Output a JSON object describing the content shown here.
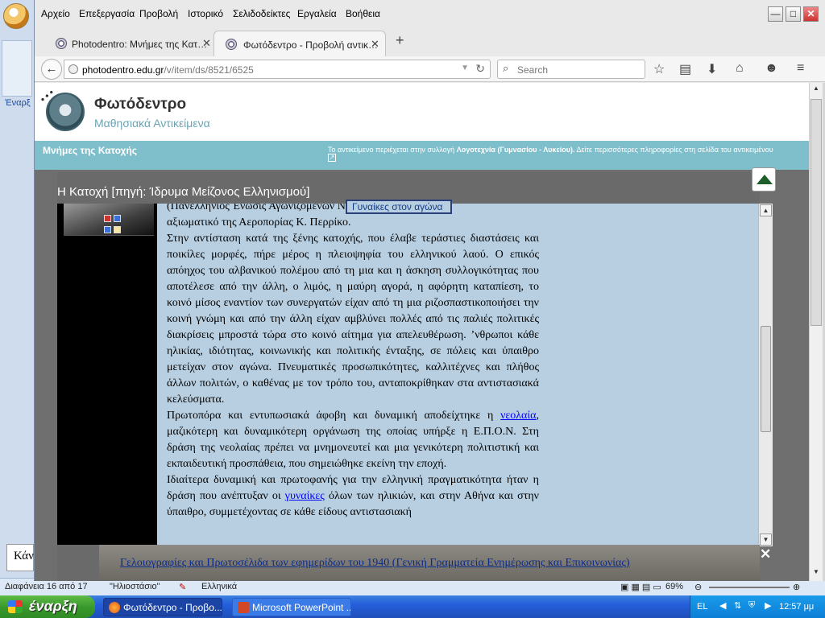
{
  "background_app": {
    "link_text": "Έναρξ",
    "thumb_text": "Κάν",
    "status_slide": "Διαφάνεια 16 από 17",
    "status_theme": "\"Ηλιοστάσιο\"",
    "status_lang": "Ελληνικά",
    "zoom": "69%"
  },
  "menu": [
    "Αρχείο",
    "Επεξεργασία",
    "Προβολή",
    "Ιστορικό",
    "Σελιδοδείκτες",
    "Εργαλεία",
    "Βοήθεια"
  ],
  "tabs": [
    {
      "title": "Photodentro: Μνήμες της Κατ…"
    },
    {
      "title": "Φωτόδεντρο - Προβολή αντικ…"
    }
  ],
  "navbar": {
    "url_host": "photodentro.edu.gr",
    "url_path": "/v/item/ds/8521/6525",
    "search_placeholder": "Search"
  },
  "site": {
    "title": "Φωτόδεντρο",
    "subtitle": "Μαθησιακά Αντικείμενα",
    "collection_title": "Μνήμες της Κατοχής",
    "info_prefix": "Το αντικείμενο περιέχεται στην συλλογή ",
    "info_collection": "Λογοτεχνία (Γυμνασίου - Λυκείου).",
    "info_suffix": " Δείτε περισσότερες πληροφορίες στη σελίδα του αντικειμένου"
  },
  "viewer": {
    "title": "Η Κατοχή [πηγή: Ίδρυμα Μείζονος Ελληνισμού]",
    "tag_box": "Γυναίκες στον αγώνα",
    "line_partial_1": "(Πανελλήνιος Ένωσις Αγωνιζομένων Νέων) που είχε ω",
    "line_partial_2": "αξιωματικό της Αεροπορίας Κ. Περρίκο.",
    "para1": "Στην αντίσταση κατά της ξένης κατοχής, που έλαβε τεράστιες διαστάσεις και ποικίλες μορφές, πήρε μέρος η πλειοψηφία του ελληνικού λαού. Ο επικός απόηχος του αλβανικού πολέμου από τη μια και η άσκηση συλλογικότητας που αποτέλεσε από την άλλη, ο λιμός, η μαύρη αγορά, η αφόρητη καταπίεση, το κοινό μίσος εναντίον των συνεργατών είχαν από τη μια ριζοσπαστικοποιήσει την κοινή γνώμη και από την άλλη είχαν αμβλύνει πολλές από τις παλιές πολιτικές διακρίσεις μπροστά τώρα στο κοινό αίτημα για απελευθέρωση. ʼνθρωποι κάθε ηλικίας, ιδιότητας, κοινωνικής και πολιτικής ένταξης, σε πόλεις και ύπαιθρο μετείχαν στον αγώνα. Πνευματικές προσωπικότητες, καλλιτέχνες και πλήθος άλλων πολιτών, ο καθένας με τον τρόπο του, ανταποκρίθηκαν στα αντιστασιακά κελεύσματα.",
    "para2_before": "Πρωτοπόρα και εντυπωσιακά άφοβη και δυναμική αποδείχτηκε η ",
    "para2_link": "νεολαία",
    "para2_after": ", μαζικότερη και δυναμικότερη οργάνωση της οποίας υπήρξε η Ε.Π.Ο.Ν. Στη δράση της νεολαίας πρέπει να μνημονευτεί και μια γενικότερη πολιτιστική και εκπαιδευτική προσπάθεια, που σημειώθηκε εκείνη την εποχή.",
    "para3_before": "Ιδιαίτερα δυναμική και πρωτοφανής για την ελληνική πραγματικότητα ήταν η δράση που ανέπτυξαν οι ",
    "para3_link": "γυναίκες",
    "para3_after": " όλων των ηλικιών, και στην Αθήνα και στην ύπαιθρο, συμμετέχοντας σε κάθε είδους αντιστασιακή",
    "caption": "Γελοιογραφίες και Πρωτοσέλιδα των εφημερίδων του 1940 (Γενική Γραμματεία Ενημέρωσης και Επικοινωνίας)",
    "close_glyph": "✕"
  },
  "taskbar": {
    "start_label": "έναρξη",
    "tasks": [
      {
        "label": "Φωτόδεντρο - Προβο..."
      },
      {
        "label": "Microsoft PowerPoint ..."
      }
    ],
    "lang": "EL",
    "time": "12:57 μμ"
  }
}
